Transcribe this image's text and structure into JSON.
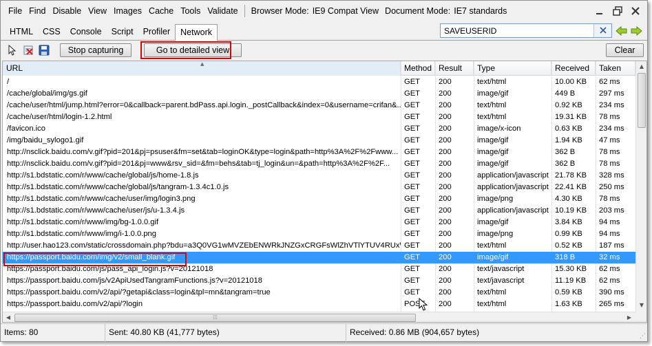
{
  "menu": {
    "items": [
      "File",
      "Find",
      "Disable",
      "View",
      "Images",
      "Cache",
      "Tools",
      "Validate"
    ],
    "browser_mode_label": "Browser Mode:",
    "browser_mode_value": "IE9 Compat View",
    "document_mode_label": "Document Mode:",
    "document_mode_value": "IE7 standards"
  },
  "tabs": [
    "HTML",
    "CSS",
    "Console",
    "Script",
    "Profiler",
    "Network"
  ],
  "active_tab": "Network",
  "search": {
    "value": "SAVEUSERID"
  },
  "toolbar": {
    "stop_label": "Stop capturing",
    "detailed_label": "Go to detailed view",
    "clear_label": "Clear"
  },
  "columns": {
    "url": "URL",
    "method": "Method",
    "result": "Result",
    "type": "Type",
    "received": "Received",
    "taken": "Taken"
  },
  "rows": [
    {
      "url": "/",
      "method": "GET",
      "result": "200",
      "type": "text/html",
      "received": "10.00 KB",
      "taken": "62 ms"
    },
    {
      "url": "/cache/global/img/gs.gif",
      "method": "GET",
      "result": "200",
      "type": "image/gif",
      "received": "449 B",
      "taken": "297 ms"
    },
    {
      "url": "/cache/user/html/jump.html?error=0&callback=parent.bdPass.api.login._postCallback&index=0&username=crifan&...",
      "method": "GET",
      "result": "200",
      "type": "text/html",
      "received": "0.92 KB",
      "taken": "234 ms"
    },
    {
      "url": "/cache/user/html/login-1.2.html",
      "method": "GET",
      "result": "200",
      "type": "text/html",
      "received": "19.31 KB",
      "taken": "78 ms"
    },
    {
      "url": "/favicon.ico",
      "method": "GET",
      "result": "200",
      "type": "image/x-icon",
      "received": "0.63 KB",
      "taken": "234 ms"
    },
    {
      "url": "/img/baidu_sylogo1.gif",
      "method": "GET",
      "result": "200",
      "type": "image/gif",
      "received": "1.94 KB",
      "taken": "47 ms"
    },
    {
      "url": "http://nsclick.baidu.com/v.gif?pid=201&pj=psuser&fm=set&tab=loginOK&type=login&path=http%3A%2F%2Fwww...",
      "method": "GET",
      "result": "200",
      "type": "image/gif",
      "received": "362 B",
      "taken": "78 ms"
    },
    {
      "url": "http://nsclick.baidu.com/v.gif?pid=201&pj=www&rsv_sid=&fm=behs&tab=tj_login&un=&path=http%3A%2F%2F...",
      "method": "GET",
      "result": "200",
      "type": "image/gif",
      "received": "362 B",
      "taken": "78 ms"
    },
    {
      "url": "http://s1.bdstatic.com/r/www/cache/global/js/home-1.8.js",
      "method": "GET",
      "result": "200",
      "type": "application/javascript",
      "received": "21.78 KB",
      "taken": "328 ms"
    },
    {
      "url": "http://s1.bdstatic.com/r/www/cache/global/js/tangram-1.3.4c1.0.js",
      "method": "GET",
      "result": "200",
      "type": "application/javascript",
      "received": "22.41 KB",
      "taken": "250 ms"
    },
    {
      "url": "http://s1.bdstatic.com/r/www/cache/user/img/login3.png",
      "method": "GET",
      "result": "200",
      "type": "image/png",
      "received": "4.30 KB",
      "taken": "78 ms"
    },
    {
      "url": "http://s1.bdstatic.com/r/www/cache/user/js/u-1.3.4.js",
      "method": "GET",
      "result": "200",
      "type": "application/javascript",
      "received": "10.19 KB",
      "taken": "203 ms"
    },
    {
      "url": "http://s1.bdstatic.com/r/www/img/bg-1.0.0.gif",
      "method": "GET",
      "result": "200",
      "type": "image/gif",
      "received": "3.84 KB",
      "taken": "94 ms"
    },
    {
      "url": "http://s1.bdstatic.com/r/www/img/i-1.0.0.png",
      "method": "GET",
      "result": "200",
      "type": "image/png",
      "received": "0.99 KB",
      "taken": "94 ms"
    },
    {
      "url": "http://user.hao123.com/static/crossdomain.php?bdu=a3Q0VG1wMVZEbENWRkJNZGxCRGFsWlZhVTlYTUV4RUxWV...",
      "method": "GET",
      "result": "200",
      "type": "text/html",
      "received": "0.52 KB",
      "taken": "187 ms"
    },
    {
      "url": "https://passport.baidu.com/img/v2/small_blank.gif",
      "method": "GET",
      "result": "200",
      "type": "image/gif",
      "received": "318 B",
      "taken": "32 ms",
      "selected": true
    },
    {
      "url": "https://passport.baidu.com/js/pass_api_login.js?v=20121018",
      "method": "GET",
      "result": "200",
      "type": "text/javascript",
      "received": "15.30 KB",
      "taken": "62 ms"
    },
    {
      "url": "https://passport.baidu.com/js/v2ApiUsedTangramFunctions.js?v=20121018",
      "method": "GET",
      "result": "200",
      "type": "text/javascript",
      "received": "11.19 KB",
      "taken": "62 ms"
    },
    {
      "url": "https://passport.baidu.com/v2/api/?getapi&class=login&tpl=mn&tangram=true",
      "method": "GET",
      "result": "200",
      "type": "text/html",
      "received": "0.59 KB",
      "taken": "390 ms"
    },
    {
      "url": "https://passport.baidu.com/v2/api/?login",
      "method": "POST",
      "result": "200",
      "type": "text/html",
      "received": "1.63 KB",
      "taken": "265 ms"
    }
  ],
  "status": {
    "items": "Items: 80",
    "sent": "Sent: 40.80 KB (41,777 bytes)",
    "received": "Received: 0.86 MB (904,657 bytes)"
  },
  "colors": {
    "selection": "#3399ff",
    "highlight_box": "#e00000"
  }
}
